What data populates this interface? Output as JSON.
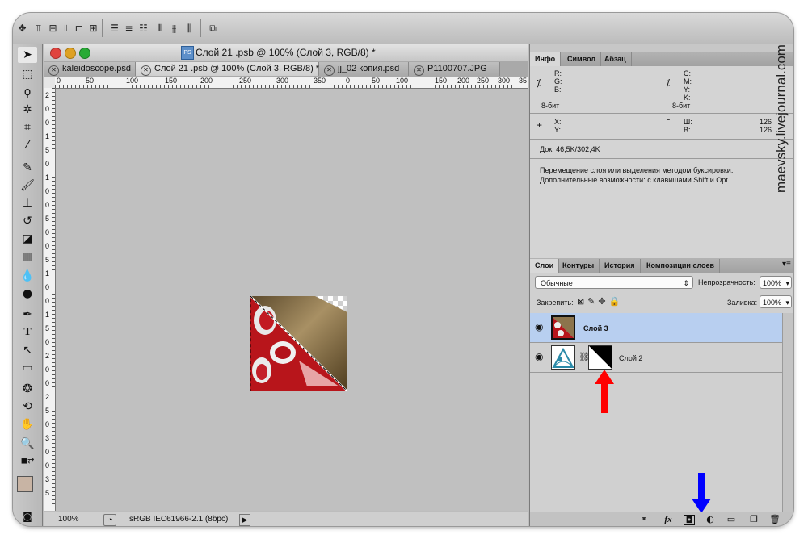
{
  "document": {
    "title": "Слой 21 .psb @ 100% (Слой 3, RGB/8) *",
    "tabs": [
      {
        "label": "kaleidoscope.psd",
        "active": false
      },
      {
        "label": "Слой 21 .psb @ 100% (Слой 3, RGB/8) *",
        "active": true
      },
      {
        "label": "jj_02 копия.psd",
        "active": false
      },
      {
        "label": "P1100707.JPG",
        "active": false
      }
    ],
    "ruler_h_labels": [
      "0",
      "50",
      "100",
      "150",
      "200",
      "250",
      "300",
      "350",
      "0",
      "50",
      "100",
      "150",
      "200",
      "250",
      "300",
      "35"
    ],
    "ruler_v_labels": [
      "2",
      "0",
      "0",
      "1",
      "5",
      "0",
      "1",
      "0",
      "0",
      "5",
      "0",
      "0",
      "5",
      "1",
      "0",
      "0",
      "1",
      "5",
      "0",
      "2",
      "0",
      "0",
      "2",
      "5",
      "0",
      "3",
      "0",
      "0",
      "3",
      "5"
    ],
    "status": {
      "zoom": "100%",
      "profile": "sRGB IEC61966-2.1 (8bpc)"
    }
  },
  "info_panel": {
    "tabs": [
      "Инфо",
      "Символ",
      "Абзац"
    ],
    "rgb_labels": [
      "R:",
      "G:",
      "B:"
    ],
    "cmyk_labels": [
      "C:",
      "M:",
      "Y:",
      "K:"
    ],
    "bit_depth_left": "8-бит",
    "bit_depth_right": "8-бит",
    "xy_labels": [
      "X:",
      "Y:"
    ],
    "wh_labels": [
      "Ш:",
      "В:"
    ],
    "w_value": "126",
    "h_value": "126",
    "doc_size": "Док: 46,5K/302,4K",
    "hint_line1": "Перемещение слоя или выделения методом буксировки.",
    "hint_line2": "Дополнительные возможности: с клавишами Shift и Opt."
  },
  "layers_panel": {
    "tabs": [
      "Слои",
      "Контуры",
      "История",
      "Композиции слоев"
    ],
    "blend_mode": "Обычные",
    "opacity_label": "Непрозрачность:",
    "opacity_value": "100%",
    "lock_label": "Закрепить:",
    "fill_label": "Заливка:",
    "fill_value": "100%",
    "layers": [
      {
        "name": "Слой 3",
        "selected": true
      },
      {
        "name": "Слой 2",
        "selected": false
      }
    ]
  },
  "watermark": "maevsky.livejournal.com",
  "colors": {
    "selected_layer": "#b8cff0",
    "red_arrow": "#ff0000",
    "blue_arrow": "#0000ff"
  },
  "icons": {
    "options_bar": [
      "move-icon",
      "align-top-icon",
      "align-vcenter-icon",
      "align-bottom-icon",
      "align-left-icon",
      "align-hcenter-icon",
      "align-right-icon",
      "distribute-top-icon",
      "distribute-vcenter-icon",
      "distribute-bottom-icon",
      "distribute-left-icon",
      "distribute-hcenter-icon",
      "distribute-right-icon",
      "auto-align-icon"
    ],
    "panel_bottom": [
      "link-layers-icon",
      "fx-icon",
      "add-mask-icon",
      "adjustment-layer-icon",
      "group-icon",
      "new-layer-icon",
      "trash-icon"
    ]
  }
}
